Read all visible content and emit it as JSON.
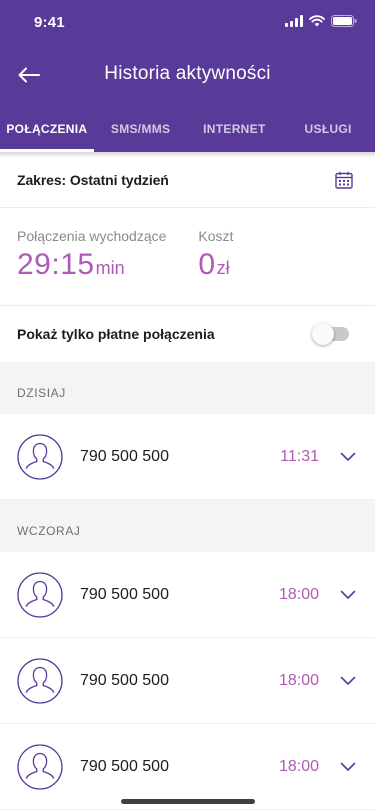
{
  "status": {
    "time": "9:41"
  },
  "header": {
    "title": "Historia aktywności"
  },
  "tabs": [
    {
      "label": "POŁĄCZENIA",
      "active": true
    },
    {
      "label": "SMS/MMS",
      "active": false
    },
    {
      "label": "INTERNET",
      "active": false
    },
    {
      "label": "USŁUGI",
      "active": false
    }
  ],
  "range": {
    "label": "Zakres: Ostatni tydzień"
  },
  "stats": {
    "outgoing_label": "Połączenia wychodzące",
    "outgoing_value": "29:15",
    "outgoing_unit": "min",
    "cost_label": "Koszt",
    "cost_value": "0",
    "cost_unit": "zł"
  },
  "filter": {
    "label": "Pokaż tylko płatne połączenia",
    "enabled": false
  },
  "sections": [
    {
      "title": "DZISIAJ",
      "calls": [
        {
          "number": "790 500 500",
          "time": "11:31"
        }
      ]
    },
    {
      "title": "WCZORAJ",
      "calls": [
        {
          "number": "790 500 500",
          "time": "18:00"
        },
        {
          "number": "790 500 500",
          "time": "18:00"
        },
        {
          "number": "790 500 500",
          "time": "18:00"
        }
      ]
    }
  ],
  "colors": {
    "brand": "#5a3a99",
    "accent": "#b05ab8"
  },
  "icons": [
    "back-arrow-icon",
    "calendar-icon",
    "avatar-icon",
    "chevron-down-icon"
  ]
}
